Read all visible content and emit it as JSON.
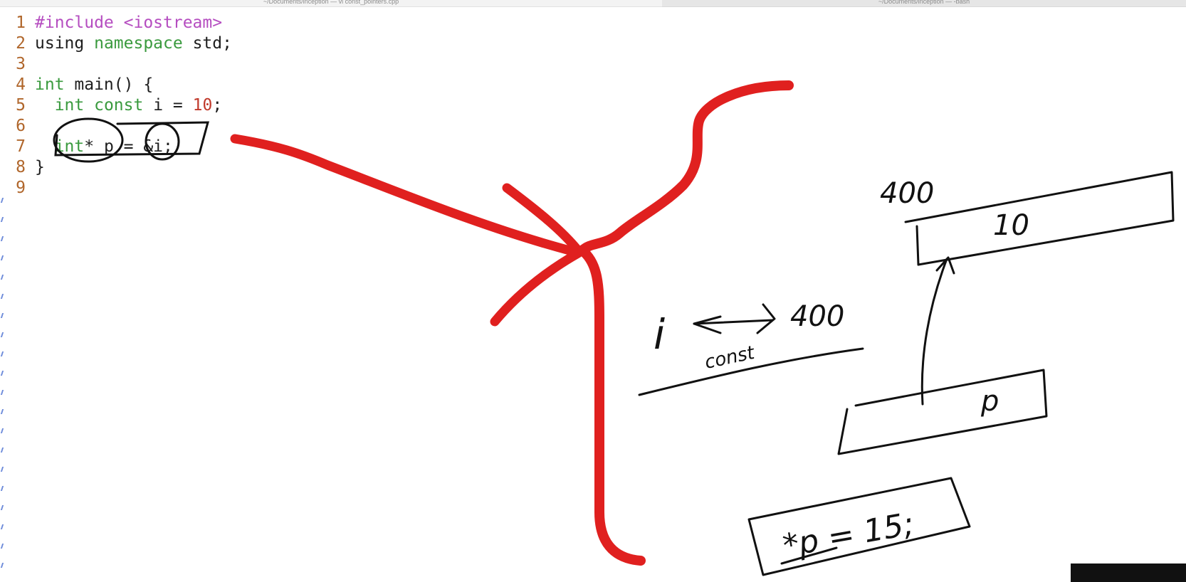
{
  "window": {
    "left_tab_title": "~/Documents/inception — vi const_pointers.cpp",
    "right_tab_title": "~/Documents/inception — -bash"
  },
  "editor": {
    "lines": [
      {
        "num": "1",
        "tokens": [
          {
            "t": "#include <iostream>",
            "k": "pre"
          }
        ]
      },
      {
        "num": "2",
        "tokens": [
          {
            "t": "using ",
            "k": "plain"
          },
          {
            "t": "namespace",
            "k": "kw"
          },
          {
            "t": " std;",
            "k": "plain"
          }
        ]
      },
      {
        "num": "3",
        "tokens": []
      },
      {
        "num": "4",
        "tokens": [
          {
            "t": "int",
            "k": "kw"
          },
          {
            "t": " main() {",
            "k": "plain"
          }
        ]
      },
      {
        "num": "5",
        "tokens": [
          {
            "t": "  ",
            "k": "plain"
          },
          {
            "t": "int",
            "k": "kw"
          },
          {
            "t": " ",
            "k": "plain"
          },
          {
            "t": "const",
            "k": "kw"
          },
          {
            "t": " i = ",
            "k": "plain"
          },
          {
            "t": "10",
            "k": "num"
          },
          {
            "t": ";",
            "k": "plain"
          }
        ]
      },
      {
        "num": "6",
        "tokens": []
      },
      {
        "num": "7",
        "tokens": [
          {
            "t": "  ",
            "k": "plain"
          },
          {
            "t": "int",
            "k": "kw"
          },
          {
            "t": "* p = &i;",
            "k": "plain"
          }
        ]
      },
      {
        "num": "8",
        "tokens": [
          {
            "t": "}",
            "k": "plain"
          }
        ]
      },
      {
        "num": "9",
        "tokens": []
      }
    ],
    "empty_line_marker": "~"
  },
  "annotations": {
    "address_label": "400",
    "box_value": "10",
    "pointer_label": "p",
    "var_label": "i",
    "const_label": "const",
    "mapped_address": "400",
    "statement": "*p = 15;"
  },
  "colors": {
    "red_ink": "#e0201f",
    "black_ink": "#111111",
    "line_number": "#b0662b",
    "keyword": "#3a9a3e",
    "preprocessor": "#b54dc0",
    "number": "#c0392b"
  }
}
